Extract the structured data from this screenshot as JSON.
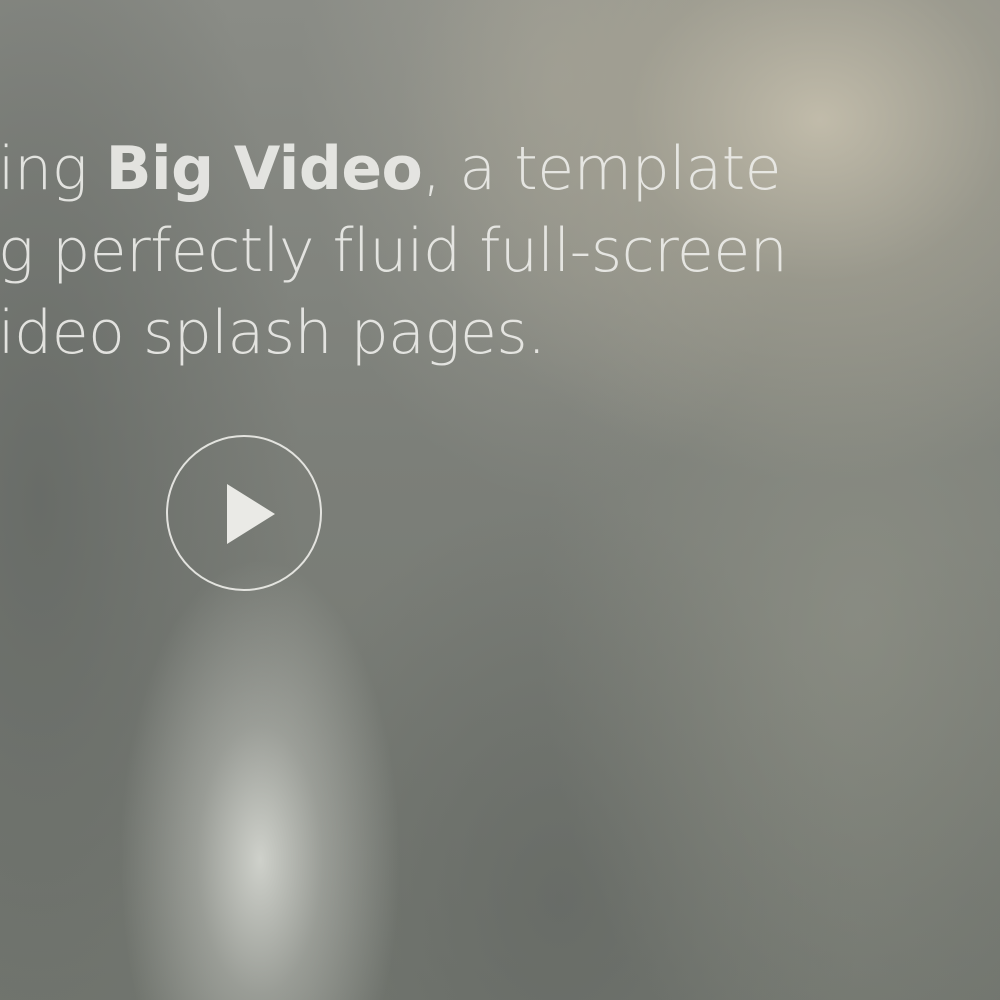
{
  "hero": {
    "line1_prefix": "ing ",
    "line1_bold": "Big Video",
    "line1_suffix": ", a template",
    "line2": "g perfectly fluid full-screen",
    "line3": "ideo splash pages."
  },
  "play_button": {
    "icon": "play-icon"
  },
  "colors": {
    "text": "#ebebe8",
    "play_outline": "#eeeeea"
  }
}
